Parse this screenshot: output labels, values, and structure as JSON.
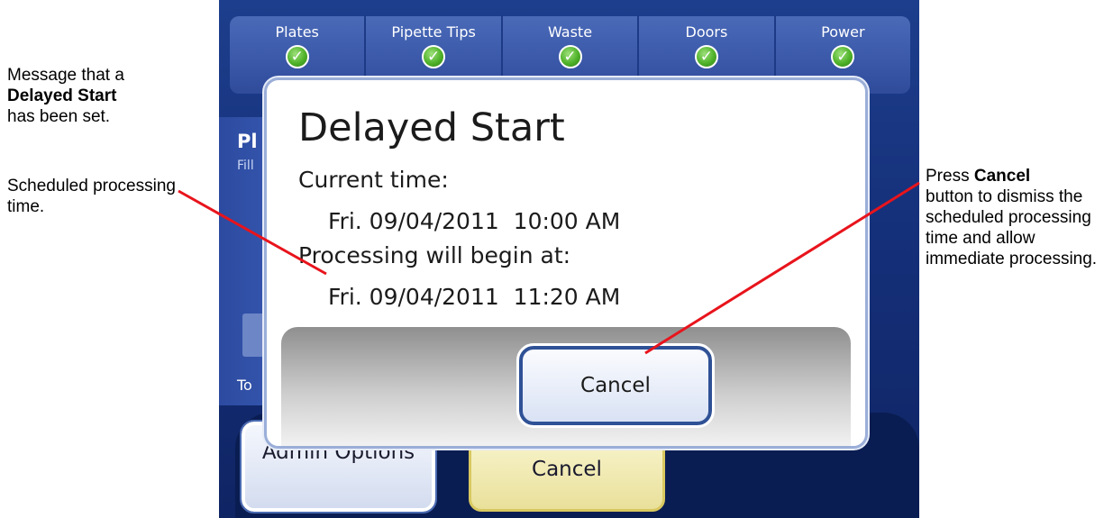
{
  "annotations": {
    "left_1_pre": "Message that a",
    "left_1_bold": "Delayed Start",
    "left_1_post": "has been set.",
    "left_2": "Scheduled processing time.",
    "right_pre": "Press",
    "right_bold": "Cancel",
    "right_post": "button to dismiss the scheduled processing time and allow immediate processing.",
    "line_color": "#e8141c"
  },
  "status_bar": [
    {
      "label": "Plates",
      "icon": "check-icon"
    },
    {
      "label": "Pipette Tips",
      "icon": "check-icon"
    },
    {
      "label": "Waste",
      "icon": "check-icon"
    },
    {
      "label": "Doors",
      "icon": "check-icon"
    },
    {
      "label": "Power",
      "icon": "check-icon"
    }
  ],
  "background": {
    "partial_title": "Pl",
    "partial_subtitle": "Fill",
    "partial_label": "To",
    "admin_button": "Admin Options",
    "cancel_button": "Cancel"
  },
  "dialog": {
    "title": "Delayed Start",
    "current_time_label": "Current time:",
    "current_time": "Fri. 09/04/2011  10:00 AM",
    "begin_label": "Processing will begin at:",
    "begin_time": "Fri. 09/04/2011  11:20 AM",
    "cancel_button": "Cancel"
  },
  "colors": {
    "screen_blue": "#1d3e8c",
    "check_green": "#4fb229",
    "dialog_button_border": "#2f5196",
    "yellow_button": "#e9e09a"
  }
}
